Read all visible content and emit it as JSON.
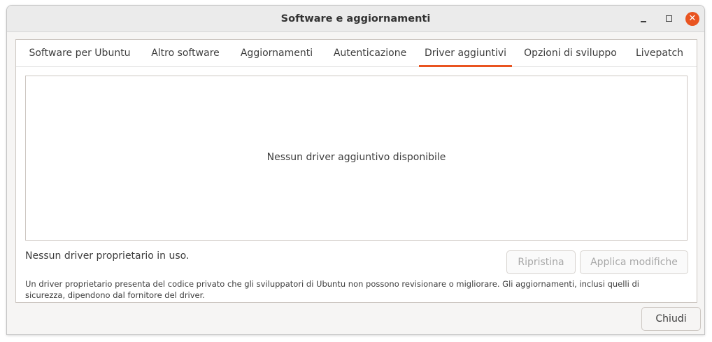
{
  "window": {
    "title": "Software e aggiornamenti",
    "close_glyph": "✕"
  },
  "tabs": [
    {
      "label": "Software per Ubuntu",
      "active": false
    },
    {
      "label": "Altro software",
      "active": false
    },
    {
      "label": "Aggiornamenti",
      "active": false
    },
    {
      "label": "Autenticazione",
      "active": false
    },
    {
      "label": "Driver aggiuntivi",
      "active": true
    },
    {
      "label": "Opzioni di sviluppo",
      "active": false
    },
    {
      "label": "Livepatch",
      "active": false
    }
  ],
  "drivers": {
    "empty_message": "Nessun driver aggiuntivo disponibile",
    "status": "Nessun driver proprietario in uso.",
    "revert_label": "Ripristina",
    "apply_label": "Applica modifiche",
    "note": "Un driver proprietario presenta del codice privato che gli sviluppatori di Ubuntu non possono revisionare o migliorare. Gli aggiornamenti, inclusi quelli di sicurezza, dipendono dal fornitore del driver."
  },
  "footer": {
    "close_label": "Chiudi"
  },
  "colors": {
    "accent": "#e95420"
  }
}
